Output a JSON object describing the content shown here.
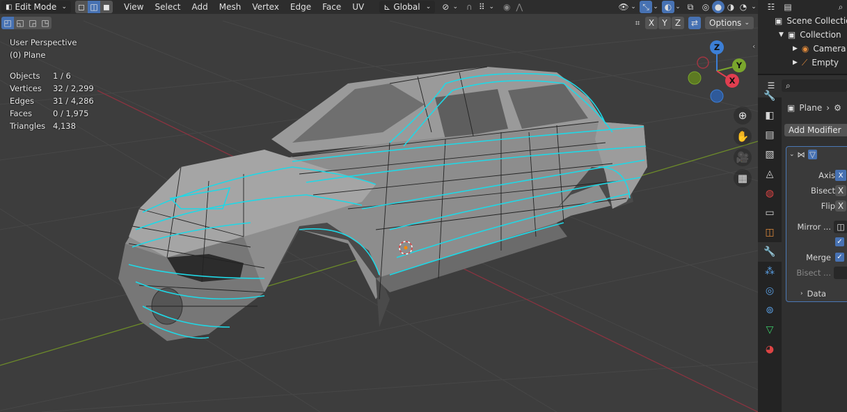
{
  "header": {
    "mode": "Edit Mode",
    "menus": [
      "View",
      "Select",
      "Add",
      "Mesh",
      "Vertex",
      "Edge",
      "Face",
      "UV"
    ],
    "orientation": "Global"
  },
  "toolbar2": {
    "axes": [
      "X",
      "Y",
      "Z"
    ],
    "options_label": "Options"
  },
  "overlay": {
    "view_name": "User Perspective",
    "object_name": "(0) Plane",
    "stats": [
      {
        "label": "Objects",
        "value": "1 / 6"
      },
      {
        "label": "Vertices",
        "value": "32 / 2,299"
      },
      {
        "label": "Edges",
        "value": "31 / 4,286"
      },
      {
        "label": "Faces",
        "value": "0 / 1,975"
      },
      {
        "label": "Triangles",
        "value": "4,138"
      }
    ]
  },
  "gizmo": {
    "x": "X",
    "y": "Y",
    "z": "Z"
  },
  "colors": {
    "x_axis": "#e03e4f",
    "y_axis": "#7aa62d",
    "z_axis": "#3c7fd6",
    "selected_edges": "#1fd8e6",
    "accent": "#4772b3"
  },
  "outliner": {
    "items": [
      {
        "label": "Scene Collection",
        "icon": "scene-collection-icon"
      },
      {
        "label": "Collection",
        "icon": "collection-icon"
      },
      {
        "label": "Camera",
        "icon": "camera-icon"
      },
      {
        "label": "Empty",
        "icon": "empty-icon"
      }
    ]
  },
  "properties": {
    "breadcrumb": "Plane",
    "add_modifier": "Add Modifier",
    "rows": {
      "axis": "Axis",
      "bisect": "Bisect",
      "flip": "Flip",
      "mirror": "Mirror ...",
      "merge": "Merge",
      "bisect_dist": "Bisect ...",
      "data": "Data",
      "x": "X"
    }
  }
}
